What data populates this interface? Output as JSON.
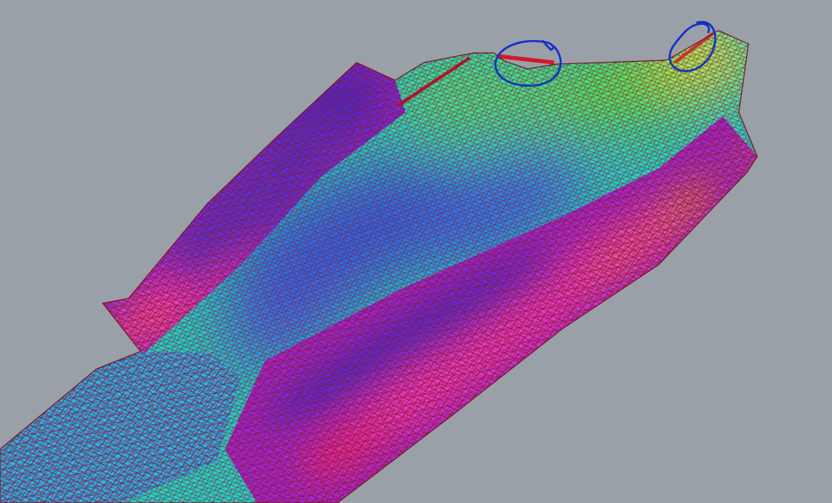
{
  "viewport": {
    "background_color": "#9aa0a7"
  },
  "mesh": {
    "wire_color": "#8a1a2a",
    "palette": {
      "edge_hot": "#ff4fa0",
      "magenta": "#e23cff",
      "violet": "#7a2cf5",
      "blue": "#2e2bf0",
      "cyan": "#19c8ff",
      "teal": "#27dfc4",
      "green": "#42e05a",
      "yellow": "#f2ee2a",
      "orange": "#ff9a20",
      "red": "#ff2a1a"
    }
  },
  "annotations": {
    "marker_color": "#1432c8",
    "items": [
      {
        "name": "left-circle-annotation"
      },
      {
        "name": "right-circle-annotation"
      }
    ]
  }
}
